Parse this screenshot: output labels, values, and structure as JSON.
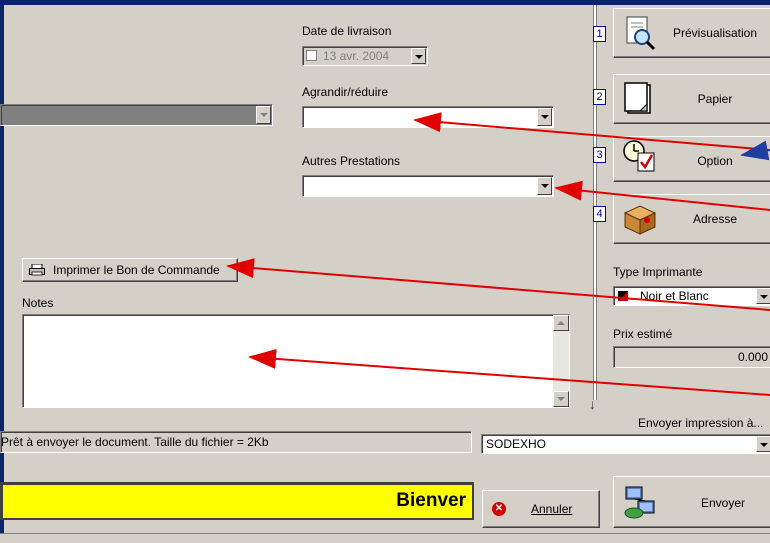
{
  "fields": {
    "date_label": "Date de livraison",
    "date_value": "13 avr. 2004",
    "agrandir_label": "Agrandir/réduire",
    "agrandir_value": "",
    "autres_label": "Autres Prestations",
    "autres_value": ""
  },
  "print_order_button": {
    "label": "Imprimer le Bon de Commande"
  },
  "notes": {
    "label": "Notes",
    "value": ""
  },
  "side_buttons": [
    {
      "number": "1",
      "label": "Prévisualisation",
      "icon": "magnifier-page-icon"
    },
    {
      "number": "2",
      "label": "Papier",
      "icon": "paper-sheet-icon"
    },
    {
      "number": "3",
      "label": "Option",
      "icon": "clock-check-icon"
    },
    {
      "number": "4",
      "label": "Adresse",
      "icon": "package-icon"
    }
  ],
  "printer": {
    "type_label": "Type Imprimante",
    "type_value": "Noir et Blanc",
    "price_label": "Prix estimé",
    "price_value": "0.000"
  },
  "send_to": {
    "label": "Envoyer impression à...",
    "value": "SODEXHO"
  },
  "status": {
    "text": "Prêt à envoyer le document. Taille du fichier = 2Kb"
  },
  "welcome": {
    "text": "Bienver"
  },
  "actions": {
    "cancel_label": "Annuler",
    "send_label": "Envoyer"
  },
  "colors": {
    "window_bg": "#d4d0c8",
    "welcome_bg": "#ffff00",
    "annotation_arrow": "#e00000",
    "frame": "#0a246a"
  }
}
